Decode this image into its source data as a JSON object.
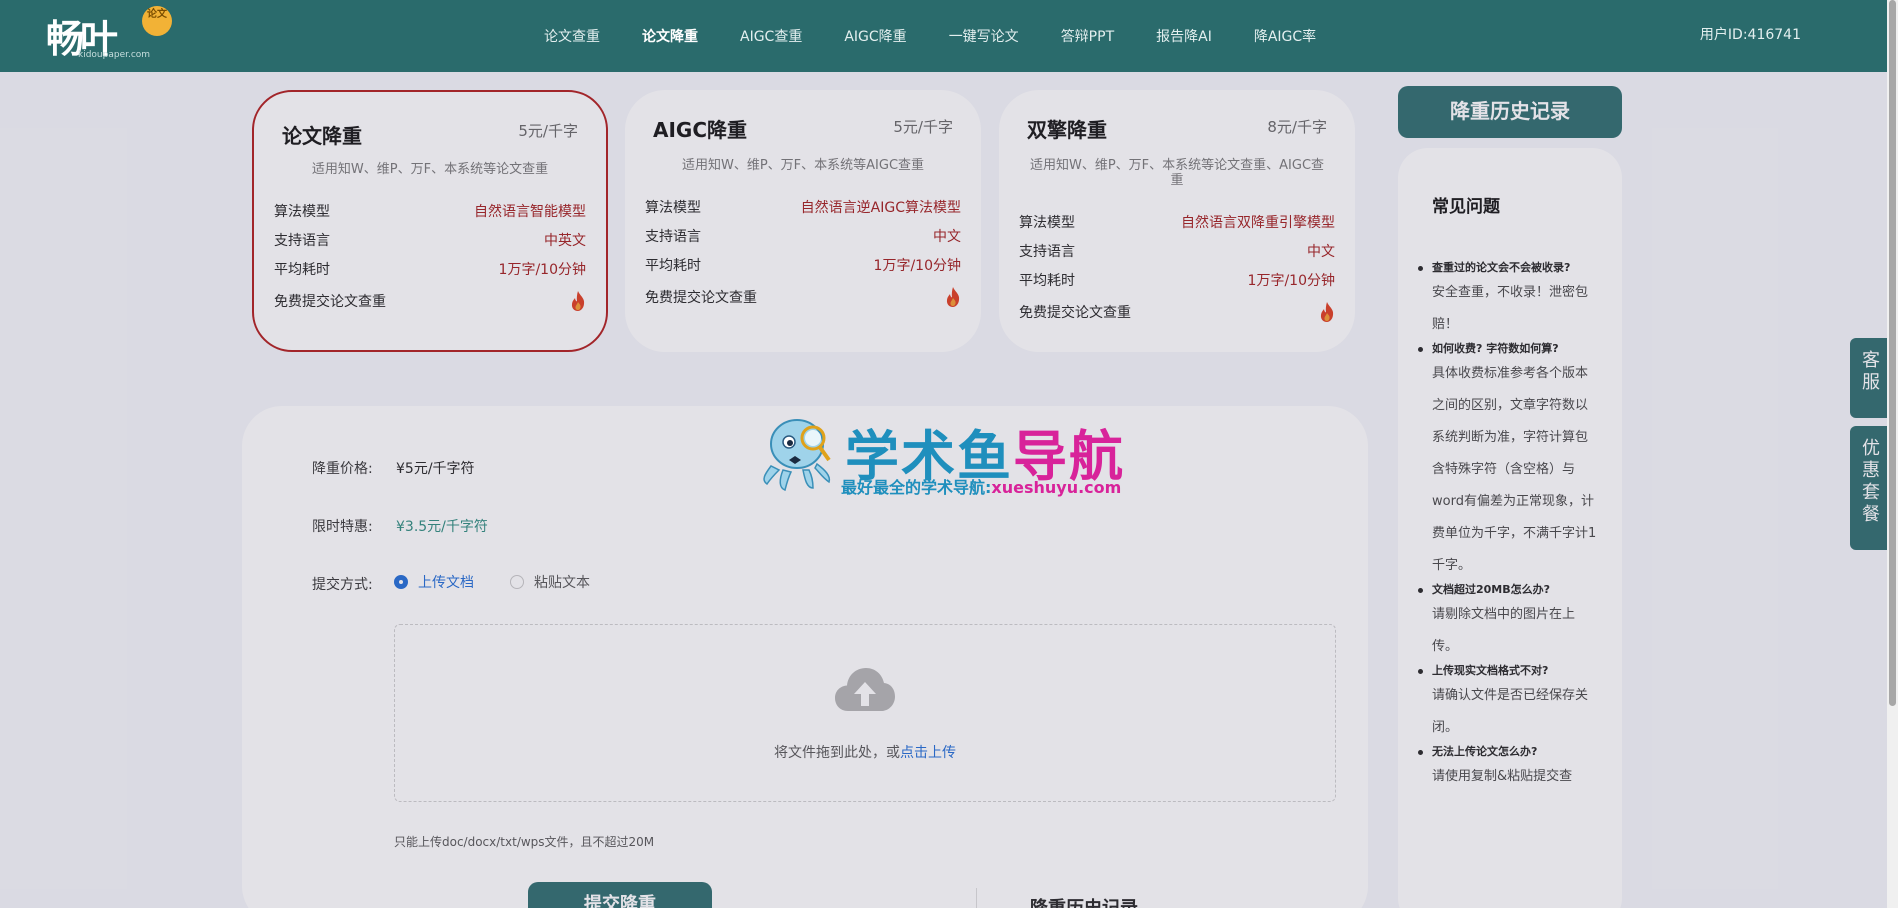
{
  "header": {
    "logo_text": "畅叶",
    "logo_badge": "论文",
    "logo_sub": "kidoupaper.com",
    "nav": [
      "论文查重",
      "论文降重",
      "AIGC查重",
      "AIGC降重",
      "一键写论文",
      "答辩PPT",
      "报告降AI",
      "降AIGC率"
    ],
    "active_nav": "论文降重",
    "user_id": "用户ID:416741"
  },
  "cards": [
    {
      "title": "论文降重",
      "price": "5元/千字",
      "desc": "适用知W、维P、万F、本系统等论文查重",
      "rows": [
        {
          "k": "算法模型",
          "v": "自然语言智能模型"
        },
        {
          "k": "支持语言",
          "v": "中英文"
        },
        {
          "k": "平均耗时",
          "v": "1万字/10分钟"
        }
      ],
      "free": "免费提交论文查重",
      "selected": true
    },
    {
      "title": "AIGC降重",
      "price": "5元/千字",
      "desc": "适用知W、维P、万F、本系统等AIGC查重",
      "rows": [
        {
          "k": "算法模型",
          "v": "自然语言逆AIGC算法模型"
        },
        {
          "k": "支持语言",
          "v": "中文"
        },
        {
          "k": "平均耗时",
          "v": "1万字/10分钟"
        }
      ],
      "free": "免费提交论文查重",
      "selected": false
    },
    {
      "title": "双擎降重",
      "price": "8元/千字",
      "desc": "适用知W、维P、万F、本系统等论文查重、AIGC查重",
      "rows": [
        {
          "k": "算法模型",
          "v": "自然语言双降重引擎模型"
        },
        {
          "k": "支持语言",
          "v": "中文"
        },
        {
          "k": "平均耗时",
          "v": "1万字/10分钟"
        }
      ],
      "free": "免费提交论文查重",
      "selected": false
    }
  ],
  "form": {
    "price_label": "降重价格:",
    "price_value": "¥5元/千字符",
    "special_label": "限时特惠:",
    "special_value": "¥3.5元/千字符",
    "method_label": "提交方式:",
    "method_options": [
      "上传文档",
      "粘贴文本"
    ],
    "method_selected": "上传文档",
    "drop_text": "将文件拖到此处，或",
    "drop_link": "点击上传",
    "hint": "只能上传doc/docx/txt/wps文件，且不超过20M",
    "submit": "提交降重",
    "history_tab": "降重历史记录"
  },
  "sidebar": {
    "history_button": "降重历史记录",
    "faq_title": "常见问题",
    "faq": [
      {
        "q": "查重过的论文会不会被收录?",
        "a": "安全查重，不收录！泄密包赔！"
      },
      {
        "q": "如何收费? 字符数如何算?",
        "a": "具体收费标准参考各个版本之间的区别，文章字符数以系统判断为准，字符计算包含特殊字符（含空格）与word有偏差为正常现象，计费单位为千字，不满千字计1千字。"
      },
      {
        "q": "文档超过20MB怎么办?",
        "a": "请剔除文档中的图片在上传。"
      },
      {
        "q": "上传现实文档格式不对?",
        "a": "请确认文件是否已经保存关闭。"
      },
      {
        "q": "无法上传论文怎么办?",
        "a": "请使用复制&粘贴提交查"
      }
    ]
  },
  "side_tabs": [
    {
      "label": "客服"
    },
    {
      "label": "优惠套餐"
    }
  ],
  "watermark": {
    "title_blue": "学术鱼",
    "title_pink": "导航",
    "sub_blue": "最好最全的学术导航:",
    "sub_pink": "xueshuyu.com"
  },
  "colors": {
    "brand": "#2a6b6c",
    "accent_red": "#a31a1a",
    "link_blue": "#1e6bd6"
  }
}
